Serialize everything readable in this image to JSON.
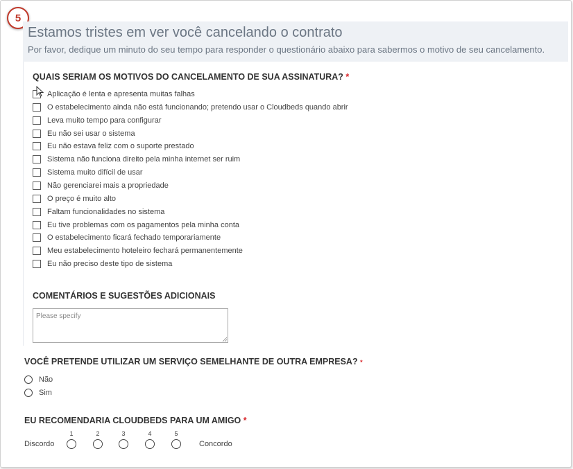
{
  "step_number": "5",
  "header": {
    "title": "Estamos tristes em ver você cancelando o contrato",
    "subtitle": "Por favor, dedique um minuto do seu tempo para responder o questionário abaixo para sabermos o motivo de seu cancelamento."
  },
  "reasons": {
    "title": "QUAIS SERIAM OS MOTIVOS DO CANCELAMENTO DE SUA ASSINATURA?",
    "required_mark": "*",
    "options": [
      "Aplicação é lenta e apresenta muitas falhas",
      "O estabelecimento ainda não está funcionando; pretendo usar o Cloudbeds quando abrir",
      "Leva muito tempo para configurar",
      "Eu não sei usar o sistema",
      "Eu não estava feliz com o suporte prestado",
      "Sistema não funciona direito pela minha internet ser ruim",
      "Sistema muito difícil de usar",
      "Não gerenciarei mais a propriedade",
      "O preço é muito alto",
      "Faltam funcionalidades no sistema",
      "Eu tive problemas com os pagamentos pela minha conta",
      "O estabelecimento ficará fechado temporariamente",
      "Meu estabelecimento hoteleiro fechará permanentemente",
      "Eu não preciso deste tipo de sistema"
    ]
  },
  "comments": {
    "title": "COMENTÁRIOS E SUGESTÕES ADICIONAIS",
    "placeholder": "Please specify"
  },
  "similar_service": {
    "title": "VOCÊ PRETENDE UTILIZAR UM SERVIÇO SEMELHANTE DE OUTRA EMPRESA?",
    "required_mark": "*",
    "options": [
      "Não",
      "Sim"
    ]
  },
  "recommend": {
    "title": "EU RECOMENDARIA CLOUDBEDS PARA UM AMIGO",
    "required_mark": "*",
    "min_label": "Discordo",
    "max_label": "Concordo",
    "scale": [
      "1",
      "2",
      "3",
      "4",
      "5"
    ]
  },
  "colors": {
    "accent_red": "#d9262b",
    "header_bg": "#eef1f5",
    "header_text": "#6b7683"
  }
}
